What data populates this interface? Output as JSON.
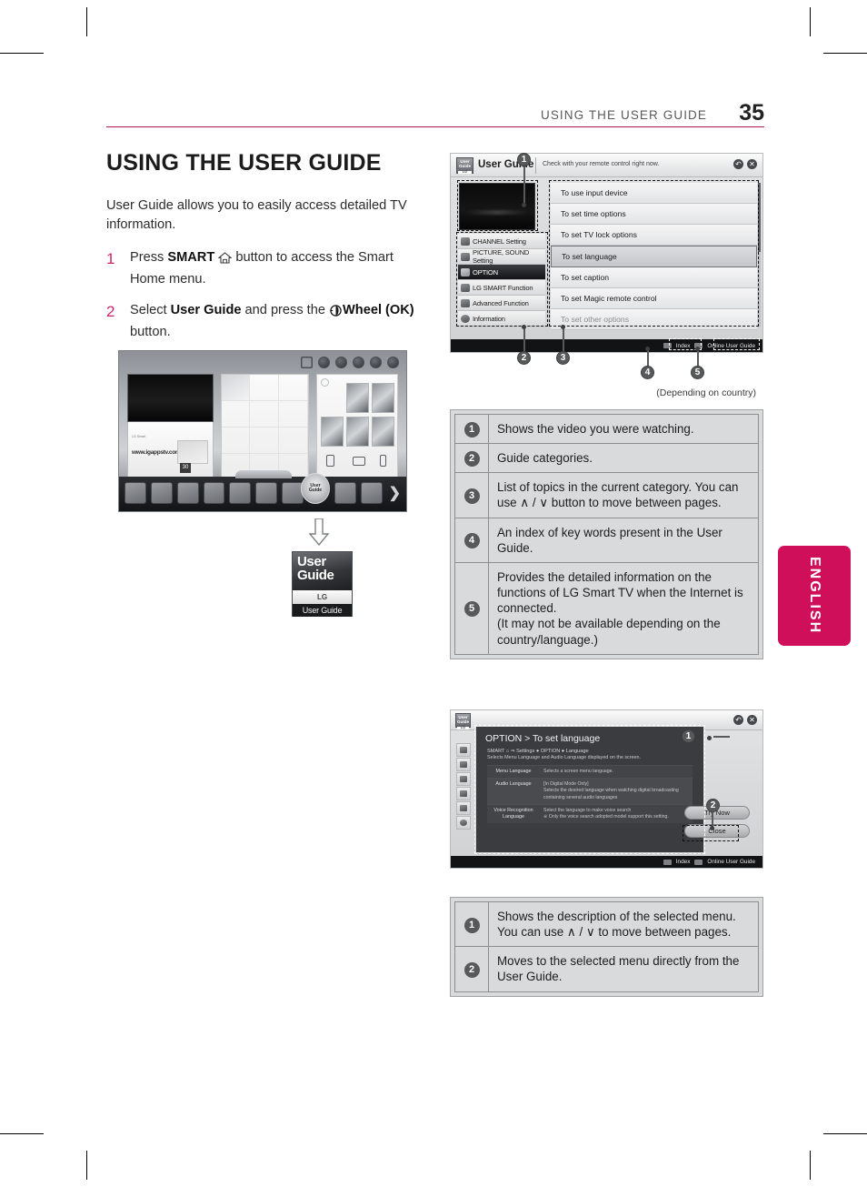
{
  "header": {
    "section_title": "USING THE USER GUIDE",
    "page_number": "35"
  },
  "left_column": {
    "title": "USING THE USER GUIDE",
    "intro": "User Guide allows you to easily access detailed TV information.",
    "steps": [
      {
        "num": "1",
        "pre": "Press ",
        "bold1": "SMART",
        "icon": "home-icon",
        "post": " button to access the Smart Home menu."
      },
      {
        "num": "2",
        "pre": "Select ",
        "bold1": "User Guide",
        "mid": " and press the ",
        "icon": "wheel-icon",
        "bold2": "Wheel (OK)",
        "post": " button."
      }
    ],
    "user_guide_tile": {
      "line1": "User",
      "line2": "Guide",
      "brand": "LG",
      "caption": "User Guide"
    }
  },
  "side_tab": {
    "label": "ENGLISH",
    "color": "#cf0f59"
  },
  "tv_screen_1": {
    "app_title": "User Guide",
    "logo_line1": "User",
    "logo_line2": "Guide",
    "subtitle": "Check with your remote control right now.",
    "window_buttons": [
      "back-button",
      "close-button"
    ],
    "categories": [
      "CHANNEL Setting",
      "PICTURE, SOUND Setting",
      "OPTION",
      "LG SMART Function",
      "Advanced Function",
      "Information"
    ],
    "selected_category": "OPTION",
    "topics": [
      "To use input device",
      "To set time options",
      "To set TV lock options",
      "To set language",
      "To set caption",
      "To set Magic remote control",
      "To set other options"
    ],
    "selected_topic": "To set language",
    "footer_buttons": [
      "Index",
      "Online User Guide"
    ],
    "callouts": [
      "1",
      "2",
      "3",
      "4",
      "5"
    ],
    "note": "(Depending on country)"
  },
  "legend_1": {
    "rows": [
      {
        "num": "1",
        "text": "Shows the video you were watching."
      },
      {
        "num": "2",
        "text": "Guide categories."
      },
      {
        "num": "3",
        "text": "List of topics in the current category. You can use ∧ / ∨ button to move between pages."
      },
      {
        "num": "4",
        "text": "An index of key words present in the User Guide."
      },
      {
        "num": "5",
        "text": "Provides the detailed information on the functions of LG Smart TV when the Internet is connected.\n(It may not be available depending on the country/language.)"
      }
    ]
  },
  "tv_screen_2": {
    "dialog_title": "OPTION > To set language",
    "path": "SMART ⌂ ⇒ Settings ● OPTION ● Language",
    "description": "Selects Menu Language and Audio Language displayed on the screen.",
    "table": [
      {
        "key": "Menu Language",
        "value": "Selects a screen menu language."
      },
      {
        "key": "Audio Language",
        "value": "[In Digital Mode Only]\nSelects the desired language when watching digital broadcasting containing several audio languages"
      },
      {
        "key": "Voice Recognition Language",
        "value": "Select the language to make voice search\n※ Only the voice search adopted model support this setting."
      }
    ],
    "buttons": [
      "Try Now",
      "Close"
    ],
    "footer_buttons": [
      "Index",
      "Online User Guide"
    ],
    "callouts": [
      "1",
      "2"
    ]
  },
  "legend_2": {
    "rows": [
      {
        "num": "1",
        "text": "Shows the description of the selected menu. You can use ∧ / ∨ to move between pages."
      },
      {
        "num": "2",
        "text": "Moves to the selected menu directly from the User Guide."
      }
    ]
  }
}
